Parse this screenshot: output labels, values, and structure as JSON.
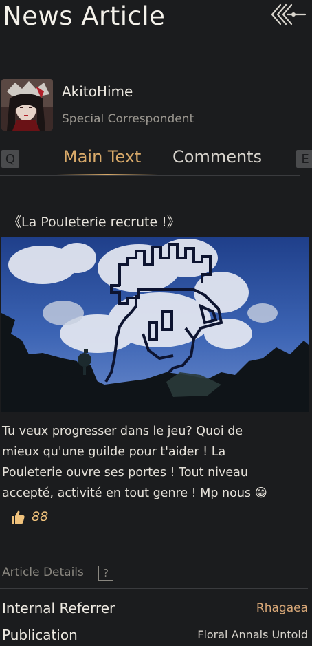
{
  "header": {
    "title": "News Article",
    "back_icon": "arrow-left-icon"
  },
  "author": {
    "name": "AkitoHime",
    "role": "Special Correspondent"
  },
  "tabs": {
    "prev_key": "Q",
    "next_key": "E",
    "items": [
      {
        "label": "Main Text",
        "active": true
      },
      {
        "label": "Comments",
        "active": false
      }
    ]
  },
  "article": {
    "headline": "《La Pouleterie recrute !》",
    "body_lines": [
      "Tu veux progresser dans le jeu? Quoi de",
      "mieux qu'une guilde pour t'aider ! La",
      "Pouleterie ouvre ses portes ! Tout niveau",
      "accepté, activité en tout genre ! Mp nous"
    ],
    "emoji": "😁",
    "likes": "88"
  },
  "details": {
    "label": "Article Details",
    "help": "?",
    "referrer_label": "Internal Referrer",
    "referrer_value": "Rhagaea",
    "publication_label": "Publication",
    "publication_value": "Floral Annals Untold"
  },
  "colors": {
    "background": "#1b1c1e",
    "accent_gold": "#d9aa6a",
    "likes": "#f0c27c",
    "link": "#d9a878"
  }
}
